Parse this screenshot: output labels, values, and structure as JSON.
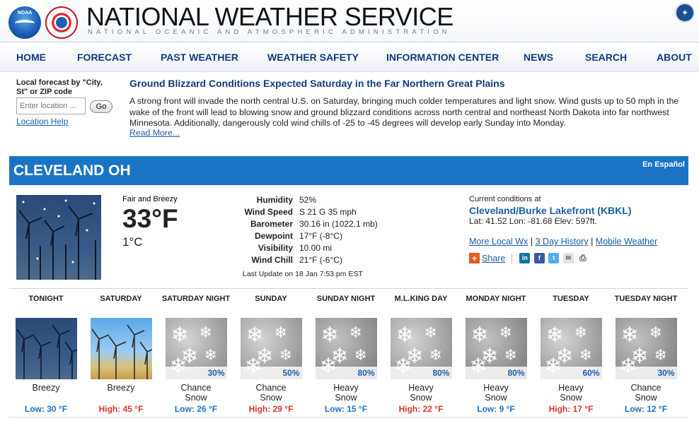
{
  "header": {
    "title": "NATIONAL WEATHER SERVICE",
    "subtitle": "NATIONAL OCEANIC AND ATMOSPHERIC ADMINISTRATION",
    "noaa_logo_text": "NOAA"
  },
  "nav": {
    "items": [
      "HOME",
      "FORECAST",
      "PAST WEATHER",
      "WEATHER SAFETY",
      "INFORMATION CENTER",
      "NEWS",
      "SEARCH",
      "ABOUT"
    ]
  },
  "local_forecast": {
    "label": "Local forecast by \"City, St\" or ZIP code",
    "placeholder": "Enter location ...",
    "go": "Go",
    "help": "Location Help"
  },
  "news": {
    "title": "Ground Blizzard Conditions Expected Saturday in the Far Northern Great Plains",
    "body": "A strong front will invade the north central U.S. on Saturday, bringing much colder temperatures and light snow. Wind gusts up to 50 mph in the wake of the front will lead to blowing snow and ground blizzard conditions across north central and northeast North Dakota into far northwest Minnesota. Additionally, dangerously cold wind chills of -25 to -45 degrees will develop early Sunday into Monday.",
    "more": "Read More..."
  },
  "city": {
    "name": "CLEVELAND OH",
    "espanol": "En Español"
  },
  "current": {
    "condition": "Fair and Breezy",
    "temp_f": "33°F",
    "temp_c": "1°C",
    "details": [
      {
        "label": "Humidity",
        "value": "52%"
      },
      {
        "label": "Wind Speed",
        "value": "S 21 G 35 mph"
      },
      {
        "label": "Barometer",
        "value": "30.16 in (1022.1 mb)"
      },
      {
        "label": "Dewpoint",
        "value": "17°F (-8°C)"
      },
      {
        "label": "Visibility",
        "value": "10.00 mi"
      },
      {
        "label": "Wind Chill",
        "value": "21°F (-6°C)"
      }
    ],
    "last_update": "Last Update on 18 Jan 7:53 pm EST",
    "current_at": "Current conditions at",
    "station": "Cleveland/Burke Lakefront (KBKL)",
    "latlon": "Lat: 41.52 Lon: -81.68 Elev: 597ft.",
    "links": [
      "More Local Wx",
      "3 Day History",
      "Mobile Weather"
    ],
    "share": "Share"
  },
  "forecast": [
    {
      "period": "TONIGHT",
      "image": "wind-night",
      "pct": "",
      "desc": "Breezy",
      "temp": "Low: 30 °F",
      "kind": "low"
    },
    {
      "period": "SATURDAY",
      "image": "wind-day",
      "pct": "",
      "desc": "Breezy",
      "temp": "High: 45 °F",
      "kind": "high"
    },
    {
      "period": "SATURDAY NIGHT",
      "image": "snow",
      "pct": "30%",
      "desc": "Chance Snow",
      "temp": "Low: 26 °F",
      "kind": "low"
    },
    {
      "period": "SUNDAY",
      "image": "snow",
      "pct": "50%",
      "desc": "Chance Snow",
      "temp": "High: 29 °F",
      "kind": "high"
    },
    {
      "period": "SUNDAY NIGHT",
      "image": "snow-dark",
      "pct": "80%",
      "desc": "Heavy Snow",
      "temp": "Low: 15 °F",
      "kind": "low"
    },
    {
      "period": "M.L.KING DAY",
      "image": "snow",
      "pct": "80%",
      "desc": "Heavy Snow",
      "temp": "High: 22 °F",
      "kind": "high"
    },
    {
      "period": "MONDAY NIGHT",
      "image": "snow-dark",
      "pct": "80%",
      "desc": "Heavy Snow",
      "temp": "Low: 9 °F",
      "kind": "low"
    },
    {
      "period": "TUESDAY",
      "image": "snow",
      "pct": "60%",
      "desc": "Heavy Snow",
      "temp": "High: 17 °F",
      "kind": "high"
    },
    {
      "period": "TUESDAY NIGHT",
      "image": "snow-dark",
      "pct": "30%",
      "desc": "Chance Snow",
      "temp": "Low: 12 °F",
      "kind": "low"
    }
  ],
  "colors": {
    "brand_blue": "#1b73c6",
    "link": "#1a5ea8",
    "low_temp": "#1b73c6",
    "high_temp": "#d9342b"
  }
}
